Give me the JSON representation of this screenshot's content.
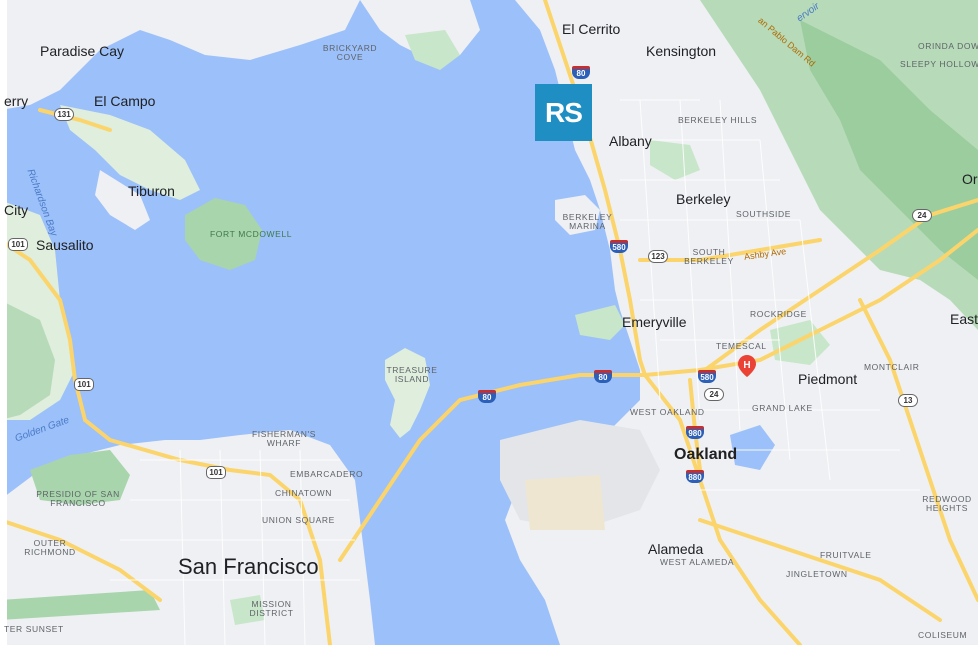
{
  "map": {
    "cities": {
      "san_francisco": "San Francisco",
      "oakland": "Oakland",
      "berkeley": "Berkeley",
      "albany": "Albany",
      "el_cerrito": "El Cerrito",
      "kensington": "Kensington",
      "emeryville": "Emeryville",
      "piedmont": "Piedmont",
      "alameda": "Alameda",
      "sausalito": "Sausalito",
      "tiburon": "Tiburon",
      "paradise_cay": "Paradise Cay",
      "el_campo": "El Campo",
      "city_fragment": "City",
      "erry_fragment": "erry",
      "orinda_fragment": "Or",
      "east_fragment": "East"
    },
    "neighborhoods": {
      "brickyard_cove": "BRICKYARD COVE",
      "berkeley_hills": "BERKELEY HILLS",
      "southside": "SOUTHSIDE",
      "south_berkeley": "SOUTH BERKELEY",
      "berkeley_marina": "BERKELEY MARINA",
      "rockridge": "ROCKRIDGE",
      "temescal": "TEMESCAL",
      "montclair": "MONTCLAIR",
      "west_oakland": "WEST OAKLAND",
      "grand_lake": "GRAND LAKE",
      "treasure_island": "TREASURE ISLAND",
      "fishermans_wharf": "FISHERMAN'S WHARF",
      "embarcadero": "EMBARCADERO",
      "chinatown": "CHINATOWN",
      "union_square": "UNION SQUARE",
      "presidio": "PRESIDIO OF SAN FRANCISCO",
      "outer_richmond": "OUTER RICHMOND",
      "mission_district": "MISSION DISTRICT",
      "outer_sunset": "TER SUNSET",
      "west_alameda": "WEST ALAMEDA",
      "fruitvale": "FRUITVALE",
      "jingletown": "JINGLETOWN",
      "redwood_heights": "REDWOOD HEIGHTS",
      "coliseum": "COLISEUM",
      "orinda_downs": "ORINDA DOW",
      "sleepy_hollow": "SLEEPY HOLLOW"
    },
    "parks": {
      "fort_mcdowell": "FORT MCDOWELL"
    },
    "water": {
      "richardson_bay": "Richardson Bay",
      "golden_gate": "Golden Gate",
      "reservoir": "ervoir"
    },
    "roads": {
      "ashby_ave": "Ashby Ave",
      "san_pablo_dam_rd": "an Pablo Dam Rd"
    },
    "shields": {
      "i80_north": "80",
      "i80_bridge": "80",
      "i80_east": "80",
      "i580": "580",
      "i580_oak": "580",
      "i980": "980",
      "i880": "880",
      "ca123": "123",
      "ca24_berk": "24",
      "ca24_oak": "24",
      "ca13": "13",
      "us101_sausalito": "101",
      "us101_marin": "101",
      "us101_sf": "101",
      "ca131": "131"
    },
    "logo_text": "RS",
    "colors": {
      "water": "#9cc0f9",
      "land": "#eef0f3",
      "park": "#c8e6c9",
      "hills": "#a8d5ac",
      "highway": "#fbd56b",
      "logo_bg": "#1f8ec3",
      "hospital": "#ea4335"
    },
    "icons": {
      "hospital": "hospital-marker-icon"
    }
  }
}
